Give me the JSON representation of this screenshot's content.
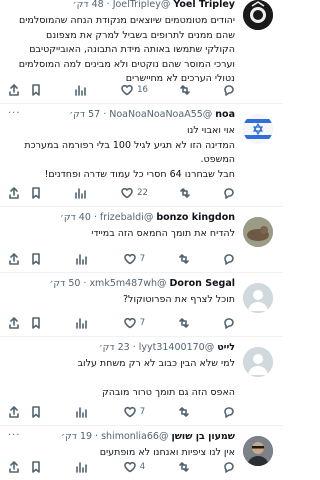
{
  "tweets": [
    {
      "name": "Yoel Tripley",
      "handle": "@JoelTripley",
      "time": "48 דק׳",
      "lines": [
        "יהודים מטומטמים שיוצאים מנקודת הנחה שהמוסלמים",
        "שהם ממנים לתרופים בשביל למרק את מצפונם",
        "הקולקי שתמשו באותה מידת התבונה, האובייקטיבם",
        "וערכי המוסר שהם נוקטים ולא מבינים למה המוסלמים",
        "נטולי הערכים לא מחיישרים"
      ],
      "likes": "16",
      "views": ""
    },
    {
      "name": "noa",
      "handle": "@NoaNoaNoaNoaA55",
      "time": "57 דק׳",
      "lines": [
        "אוי ואבוי לנו",
        "המדינה הזו לא תגיע לגיל 100 בלי רפורמה במערכת",
        "המשפט.",
        "חבל שבחרנו 64 חסרי כל עמוד שדרה ופחדנים!"
      ],
      "likes": "22",
      "views": ""
    },
    {
      "name": "bonzo kingdon",
      "handle": "@frizebaldi",
      "time": "40 דק׳",
      "lines": [
        "להדיח את תומך החמאס הזה במיידי"
      ],
      "likes": "7",
      "views": ""
    },
    {
      "name": "Doron Segal",
      "handle": "@xmk5m487wh",
      "time": "50 דק׳",
      "lines": [
        "תוכל לצרף את הפרוטוקול?"
      ],
      "likes": "7",
      "views": ""
    },
    {
      "name": "לייט",
      "handle": "@lyyt31400170",
      "time": "23 דק׳",
      "lines": [
        "למי שלא הבין כבוב לא רק משחת עלוב",
        "",
        "האפס הזה גם תומך טרור מובהק"
      ],
      "likes": "7",
      "views": ""
    },
    {
      "name": "שמעון בן שושן",
      "handle": "@shimonlia66",
      "time": "19 דק׳",
      "lines": [
        "אין לנו ציפיות ואנחנו לא מופתעים"
      ],
      "likes": "4",
      "views": ""
    }
  ]
}
